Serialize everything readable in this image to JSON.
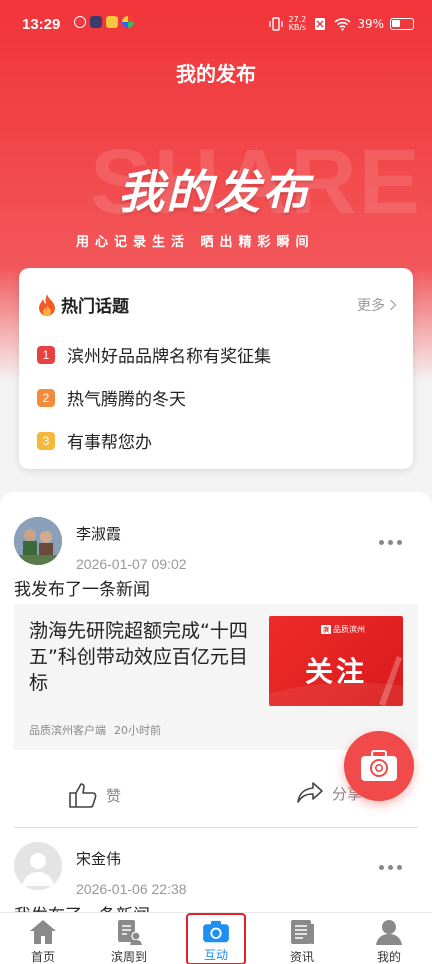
{
  "status_bar": {
    "time": "13:29",
    "net_speed_value": "27.2",
    "net_speed_unit": "KB/s",
    "battery": "39%"
  },
  "header": {
    "title": "我的发布"
  },
  "banner": {
    "bg_text": "SHARE",
    "title": "我的发布",
    "subtitle": "用心记录生活 晒出精彩瞬间"
  },
  "hot_topics": {
    "title": "热门话题",
    "more_label": "更多",
    "items": [
      {
        "rank": "1",
        "text": "滨州好品品牌名称有奖征集",
        "color": "#e8413f"
      },
      {
        "rank": "2",
        "text": "热气腾腾的冬天",
        "color": "#f28b3a"
      },
      {
        "rank": "3",
        "text": "有事帮您办",
        "color": "#f4b93a"
      }
    ]
  },
  "posts": [
    {
      "author": "李淑霞",
      "time": "2026-01-07 09:02",
      "text": "我发布了一条新闻",
      "news": {
        "title": "渤海先研院超额完成“十四五”科创带动效应百亿元目标",
        "thumb_logo": "品质滨州",
        "thumb_text": "关注",
        "source": "品质滨州客户端",
        "ago": "20小时前"
      },
      "like_label": "赞",
      "share_label": "分享"
    },
    {
      "author": "宋金伟",
      "time": "2026-01-06 22:38",
      "text": "我发布了一条新闻"
    }
  ],
  "tabbar": {
    "items": [
      {
        "label": "首页"
      },
      {
        "label": "滨周到"
      },
      {
        "label": "互动"
      },
      {
        "label": "资讯"
      },
      {
        "label": "我的"
      }
    ],
    "active_color": "#1f8ff0"
  },
  "colors": {
    "brand_red": "#f0343a",
    "fab": "#f04a4a"
  }
}
